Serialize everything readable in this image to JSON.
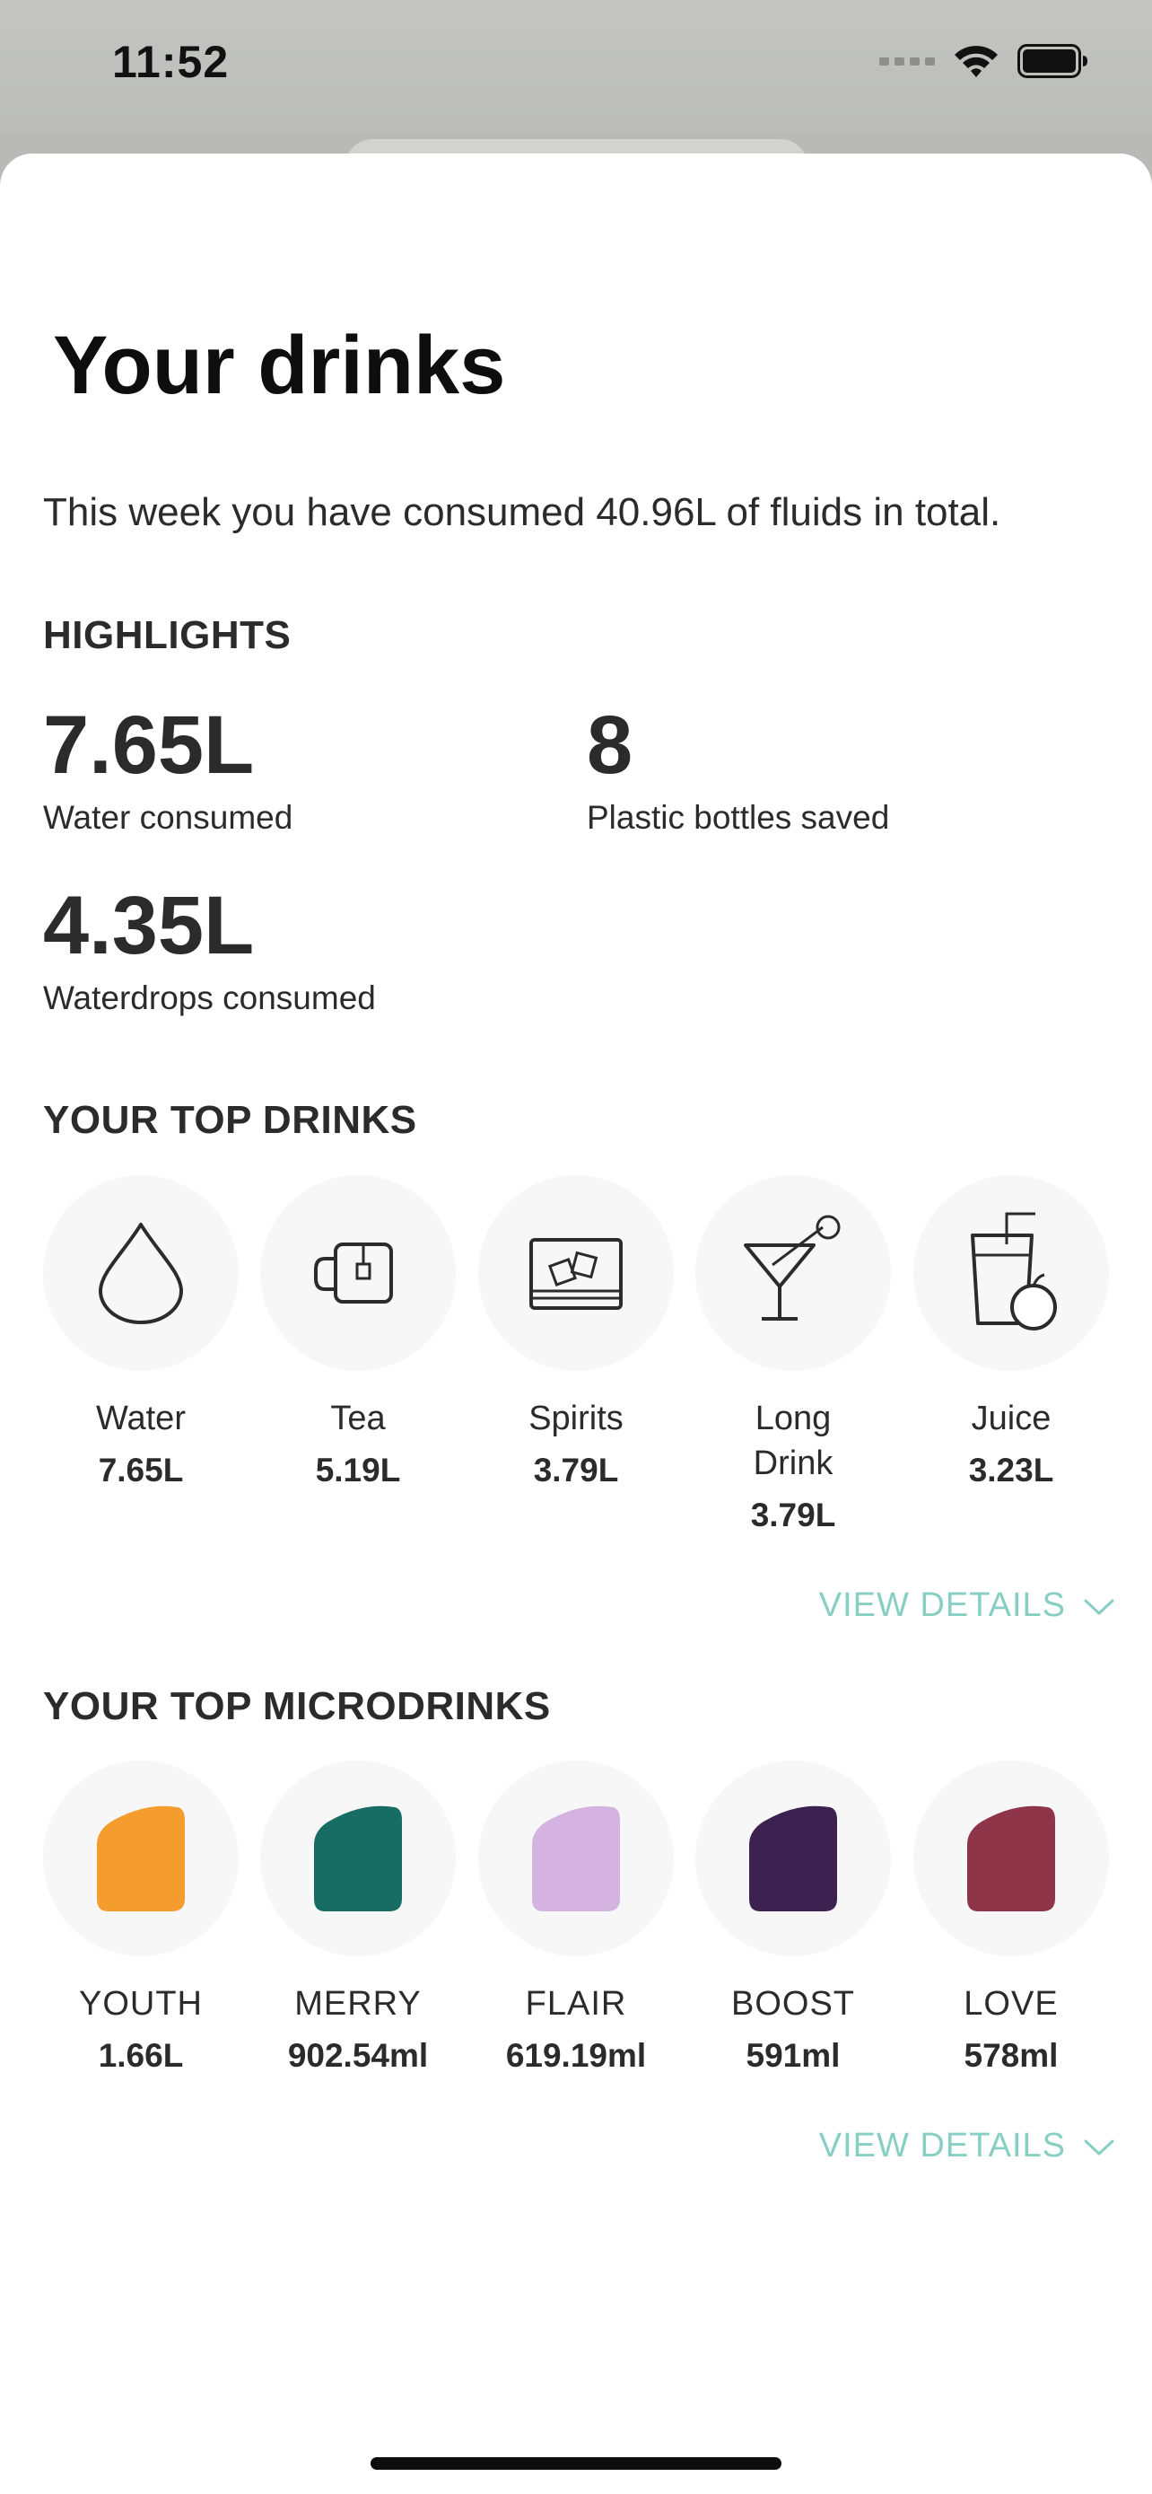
{
  "status_bar": {
    "time": "11:52"
  },
  "screen": {
    "title": "Your drinks",
    "summary": "This week you have consumed 40.96L of fluids in total."
  },
  "highlights": {
    "heading": "HIGHLIGHTS",
    "items": [
      {
        "value": "7.65L",
        "label": "Water consumed"
      },
      {
        "value": "8",
        "label": "Plastic bottles saved"
      },
      {
        "value": "4.35L",
        "label": "Waterdrops consumed"
      }
    ]
  },
  "top_drinks": {
    "heading": "YOUR TOP DRINKS",
    "items": [
      {
        "name": "Water",
        "amount": "7.65L",
        "icon": "water-drop-icon"
      },
      {
        "name": "Tea",
        "amount": "5.19L",
        "icon": "tea-cup-icon"
      },
      {
        "name": "Spirits",
        "amount": "3.79L",
        "icon": "spirits-glass-icon"
      },
      {
        "name": "Long Drink",
        "amount": "3.79L",
        "icon": "cocktail-glass-icon"
      },
      {
        "name": "Juice",
        "amount": "3.23L",
        "icon": "juice-glass-icon"
      }
    ],
    "view_details": "VIEW DETAILS"
  },
  "top_microdrinks": {
    "heading": "YOUR TOP MICRODRINKS",
    "items": [
      {
        "name": "YOUTH",
        "amount": "1.66L",
        "color": "#f59c2f"
      },
      {
        "name": "MERRY",
        "amount": "902.54ml",
        "color": "#176c63"
      },
      {
        "name": "FLAIR",
        "amount": "619.19ml",
        "color": "#d4b3e0"
      },
      {
        "name": "BOOST",
        "amount": "591ml",
        "color": "#3c2250"
      },
      {
        "name": "LOVE",
        "amount": "578ml",
        "color": "#8e3549"
      }
    ],
    "view_details": "VIEW DETAILS"
  },
  "colors": {
    "accent": "#88cfc3",
    "text": "#2b2b2b",
    "circle_bg": "#f7f7f7"
  }
}
